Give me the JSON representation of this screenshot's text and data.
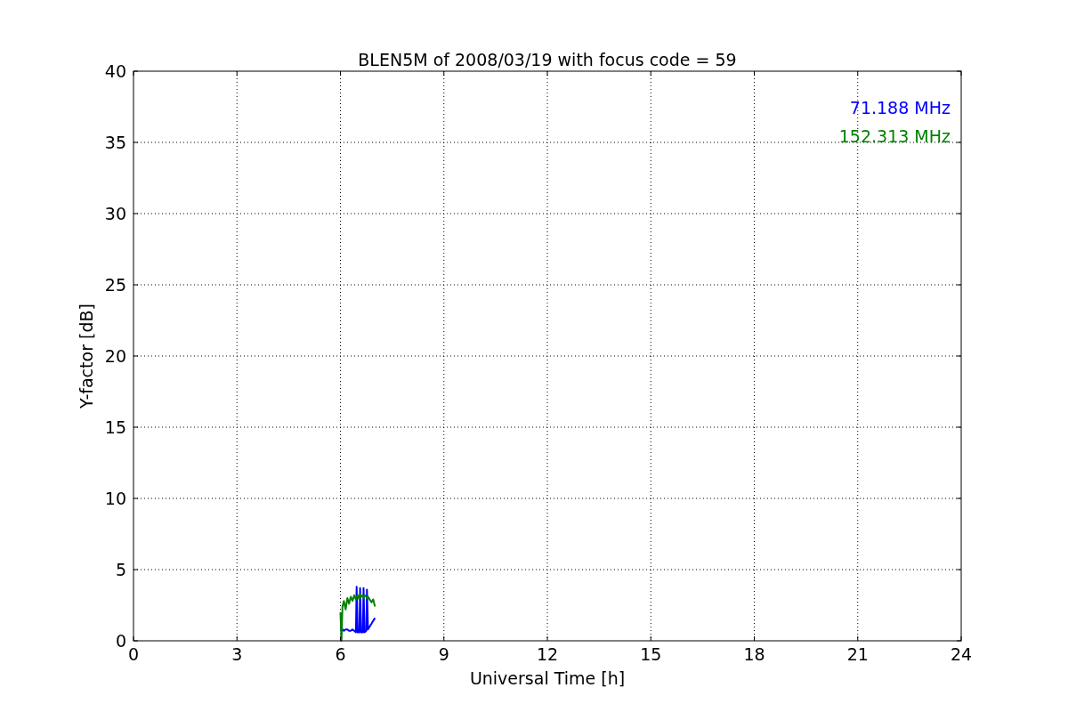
{
  "figure": {
    "chart_data": {
      "type": "line",
      "title": "BLEN5M of 2008/03/19 with focus code = 59",
      "xlabel": "Universal Time [h]",
      "ylabel": "Y-factor [dB]",
      "x": [
        6.0,
        6.03,
        6.06,
        6.1,
        6.15,
        6.2,
        6.25,
        6.3,
        6.35,
        6.4,
        6.45,
        6.47,
        6.5,
        6.55,
        6.57,
        6.6,
        6.65,
        6.67,
        6.7,
        6.75,
        6.77,
        6.8,
        6.85,
        6.9,
        6.95,
        7.0
      ],
      "series": [
        {
          "name": "71.188 MHz",
          "color": "#0000ff",
          "values": [
            0.8,
            0.9,
            0.8,
            0.7,
            0.8,
            0.8,
            0.7,
            0.7,
            0.8,
            0.7,
            0.6,
            3.8,
            0.6,
            0.6,
            3.7,
            0.6,
            0.6,
            3.7,
            0.6,
            0.7,
            3.6,
            0.8,
            1.0,
            1.2,
            1.4,
            1.6
          ]
        },
        {
          "name": "152.313 MHz",
          "color": "#008000",
          "values": [
            2.0,
            0.0,
            2.4,
            2.8,
            2.2,
            3.0,
            2.6,
            3.1,
            2.8,
            3.2,
            2.9,
            3.1,
            3.2,
            2.9,
            3.3,
            3.1,
            3.2,
            3.0,
            3.2,
            3.1,
            3.0,
            3.1,
            2.9,
            2.7,
            2.9,
            2.4
          ]
        }
      ],
      "grid": true,
      "xlim": [
        0,
        24
      ],
      "ylim": [
        0,
        40
      ],
      "xticks": [
        0,
        3,
        6,
        9,
        12,
        15,
        18,
        21,
        24
      ],
      "yticks": [
        0,
        5,
        10,
        15,
        20,
        25,
        30,
        35,
        40
      ]
    }
  }
}
